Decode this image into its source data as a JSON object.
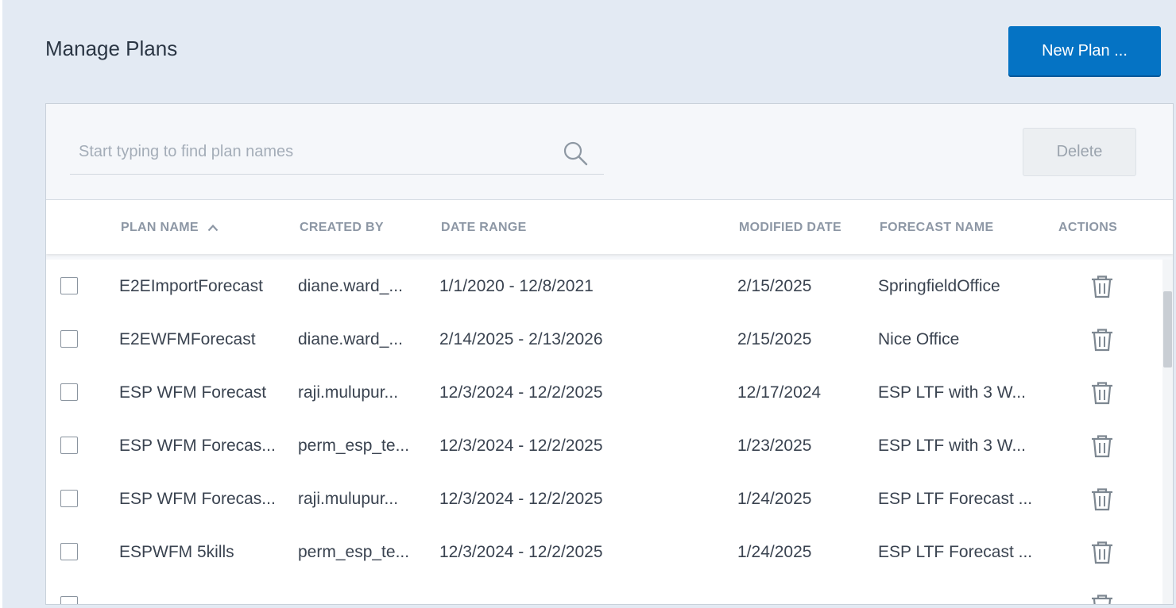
{
  "page": {
    "title": "Manage Plans"
  },
  "toolbar": {
    "new_plan_label": "New Plan ...",
    "delete_label": "Delete"
  },
  "search": {
    "placeholder": "Start typing to find plan names",
    "value": ""
  },
  "table": {
    "headers": {
      "plan_name": "PLAN NAME",
      "created_by": "CREATED BY",
      "date_range": "DATE RANGE",
      "modified_date": "MODIFIED DATE",
      "forecast_name": "FORECAST NAME",
      "actions": "ACTIONS"
    },
    "sort": {
      "column": "plan_name",
      "direction": "ascending"
    },
    "rows": [
      {
        "plan_name": "E2EImportForecast",
        "created_by": "diane.ward_...",
        "date_range": "1/1/2020 - 12/8/2021",
        "modified_date": "2/15/2025",
        "forecast_name": "SpringfieldOffice"
      },
      {
        "plan_name": "E2EWFMForecast",
        "created_by": "diane.ward_...",
        "date_range": "2/14/2025 - 2/13/2026",
        "modified_date": "2/15/2025",
        "forecast_name": "Nice Office"
      },
      {
        "plan_name": "ESP WFM Forecast",
        "created_by": "raji.mulupur...",
        "date_range": "12/3/2024 - 12/2/2025",
        "modified_date": "12/17/2024",
        "forecast_name": "ESP LTF with 3 W..."
      },
      {
        "plan_name": "ESP WFM Forecas...",
        "created_by": "perm_esp_te...",
        "date_range": "12/3/2024 - 12/2/2025",
        "modified_date": "1/23/2025",
        "forecast_name": "ESP LTF with 3 W..."
      },
      {
        "plan_name": "ESP WFM Forecas...",
        "created_by": "raji.mulupur...",
        "date_range": "12/3/2024 - 12/2/2025",
        "modified_date": "1/24/2025",
        "forecast_name": "ESP LTF Forecast ..."
      },
      {
        "plan_name": "ESPWFM 5kills",
        "created_by": "perm_esp_te...",
        "date_range": "12/3/2024 - 12/2/2025",
        "modified_date": "1/24/2025",
        "forecast_name": "ESP LTF Forecast ..."
      }
    ]
  },
  "icons": {
    "search": "search-icon",
    "sort": "chevron-up-icon",
    "delete": "trash-icon"
  },
  "colors": {
    "accent": "#0573c4",
    "background": "#e3eaf3",
    "header_text": "#8d97a5"
  }
}
